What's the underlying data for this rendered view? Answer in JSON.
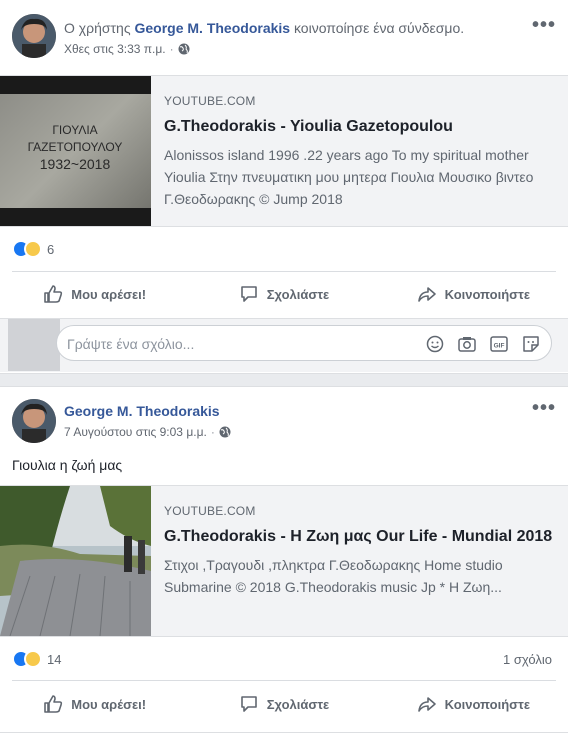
{
  "posts": [
    {
      "header_prefix": "Ο χρήστης ",
      "author": "George M. Theodorakis",
      "header_suffix": " κοινοποίησε ένα σύνδεσμο.",
      "timestamp": "Χθες στις 3:33 π.μ.",
      "more": "•••",
      "thumb_text": [
        "ΓΙΟΥΛΙΑ",
        "ΓΑΖΕΤΟΠΟΥΛΟΥ",
        "1932~2018"
      ],
      "link": {
        "domain": "YOUTUBE.COM",
        "title": "G.Theodorakis - Yioulia Gazetopoulou",
        "description": "Alonissos island 1996 .22 years ago To my spiritual mother Yioulia Στην πνευματικη μου μητερα Γιουλια Μουσικο βιντεο Γ.Θεοδωρακης © Jump 2018"
      },
      "reaction_count": "6",
      "comment_count": ""
    },
    {
      "author": "George M. Theodorakis",
      "timestamp": "7 Αυγούστου στις 9:03 μ.μ.",
      "more": "•••",
      "text": "Γιουλια η ζωή μας",
      "link": {
        "domain": "YOUTUBE.COM",
        "title": "G.Theodorakis - Η Ζωη μας Our Life - Mundial 2018",
        "description": "Στιχοι ,Τραγουδι ,πληκτρα Γ.Θεοδωρακης Home studio Submarine © 2018 G.Theodorakis music Jp * Η Ζωη..."
      },
      "reaction_count": "14",
      "comment_count": "1 σχόλιο"
    }
  ],
  "actions": {
    "like": "Μου αρέσει!",
    "comment": "Σχολιάστε",
    "share": "Κοινοποιήστε"
  },
  "comment_box": {
    "placeholder": "Γράψτε ένα σχόλιο..."
  },
  "icons": {
    "like": "thumb-up-icon",
    "comment": "speech-bubble-icon",
    "share": "share-arrow-icon",
    "emoji": "smiley-icon",
    "camera": "camera-icon",
    "gif": "gif-icon",
    "sticker": "sticker-icon",
    "privacy": "globe-icon"
  },
  "colors": {
    "link_blue": "#365899",
    "like_blue": "#1877f2",
    "sad_yellow": "#f7c94b",
    "text_gray": "#606770"
  }
}
